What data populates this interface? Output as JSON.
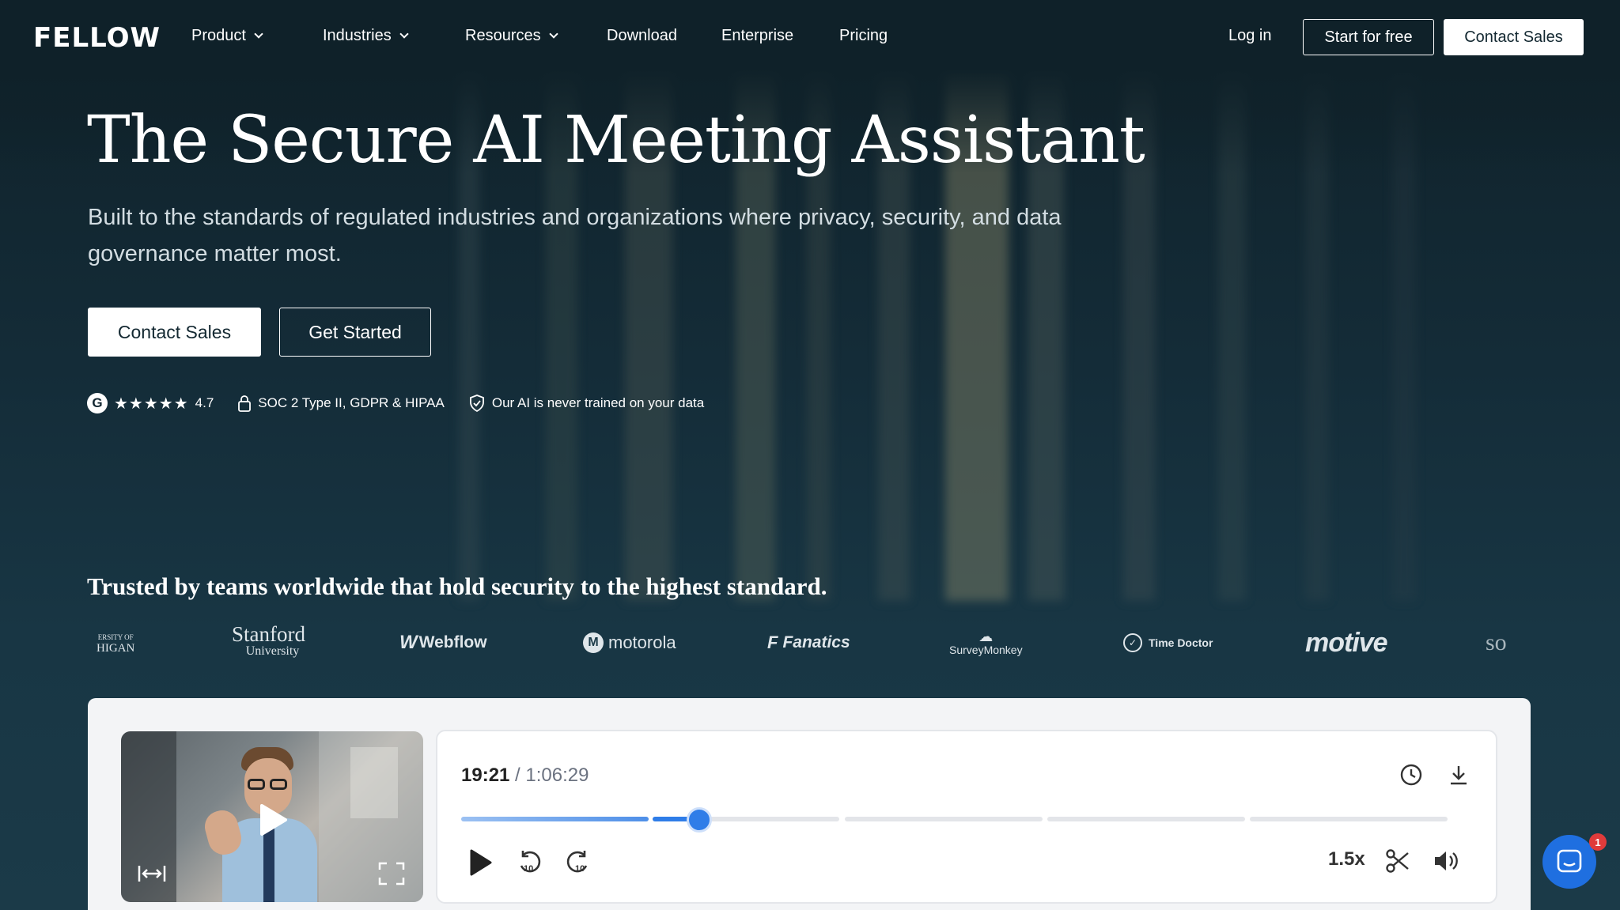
{
  "nav": {
    "logo": "FELLOW",
    "items": [
      {
        "label": "Product",
        "dropdown": true
      },
      {
        "label": "Industries",
        "dropdown": true
      },
      {
        "label": "Resources",
        "dropdown": true
      },
      {
        "label": "Download",
        "dropdown": false
      },
      {
        "label": "Enterprise",
        "dropdown": false
      },
      {
        "label": "Pricing",
        "dropdown": false
      }
    ],
    "login": "Log in",
    "start_free": "Start for free",
    "contact_sales": "Contact Sales"
  },
  "hero": {
    "title": "The Secure AI Meeting Assistant",
    "subtitle": "Built to the standards of regulated industries and organizations where privacy, security, and data governance matter most.",
    "cta_primary": "Contact Sales",
    "cta_secondary": "Get Started",
    "rating_icon": "G",
    "stars": "★★★★★",
    "rating_value": 4.7,
    "rating": "4.7",
    "compliance": "SOC 2 Type II, GDPR & HIPAA",
    "ai_note": "Our AI is never trained on your data"
  },
  "trusted": {
    "heading": "Trusted by teams worldwide that hold security to the highest standard.",
    "logos": [
      {
        "name": "ERSITY OF",
        "sub": "HIGAN"
      },
      {
        "name": "Stanford",
        "sub": "University"
      },
      {
        "name": "Webflow"
      },
      {
        "name": "motorola"
      },
      {
        "name": "Fanatics"
      },
      {
        "name": "SurveyMonkey"
      },
      {
        "name": "Time Doctor"
      },
      {
        "name": "motive"
      },
      {
        "name": "so"
      }
    ]
  },
  "player": {
    "current_time": "19:21",
    "separator": " / ",
    "total_time": "1:06:29",
    "progress": 0.235,
    "speed": "1.5x"
  },
  "chat": {
    "badge": "1"
  },
  "colors": {
    "background": "#112530",
    "accent_blue": "#2f7de8",
    "chat_blue": "#1f6fe0",
    "badge_red": "#e03b3b"
  },
  "icons": [
    "chevron-down-icon",
    "g2-icon",
    "star-icon",
    "lock-icon",
    "shield-check-icon",
    "play-icon",
    "rewind-10-icon",
    "forward-10-icon",
    "clock-icon",
    "download-icon",
    "scissors-icon",
    "volume-icon",
    "expand-icon",
    "fullscreen-icon",
    "chat-icon"
  ]
}
